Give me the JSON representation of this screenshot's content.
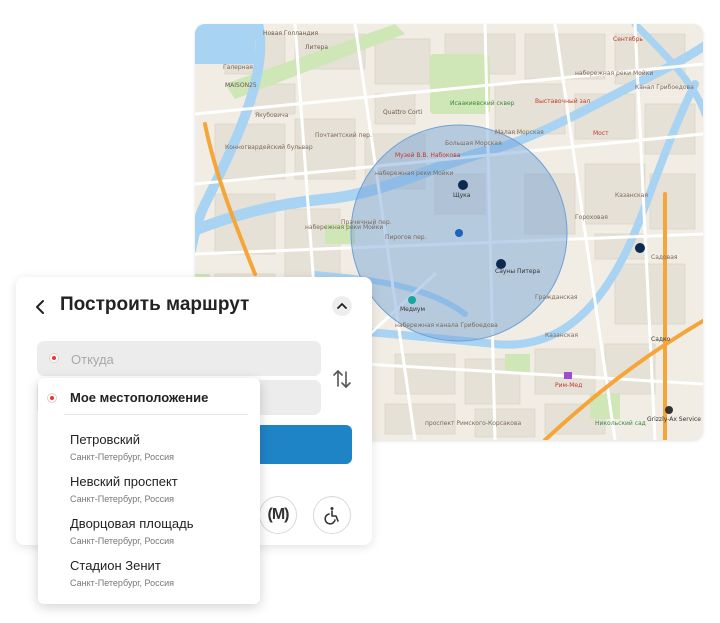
{
  "panel": {
    "title": "Построить маршрут",
    "from_placeholder": "Откуда",
    "to_value": ""
  },
  "dropdown": {
    "current_location": "Мое местоположение",
    "items": [
      {
        "name": "Петровский",
        "sub": "Санкт-Петербург, Россия"
      },
      {
        "name": "Невский проспект",
        "sub": "Санкт-Петербург, Россия"
      },
      {
        "name": "Дворцовая площадь",
        "sub": "Санкт-Петербург, Россия"
      },
      {
        "name": "Стадион Зенит",
        "sub": "Санкт-Петербург, Россия"
      }
    ]
  },
  "map": {
    "labels": {
      "newholland": "Новая Голландия",
      "litera": "Литера",
      "galernaya": "Галерная",
      "maisonsouth": "MAISON25",
      "yakubovicha": "Якубовича",
      "konnogvardeisky": "Конногвардейский бульвар",
      "pochtamtsky": "Почтамтский пер.",
      "quattro": "Quattro Corti",
      "isaac": "Исаакиевский сквер",
      "malaya_morskaya": "Малая Морская",
      "bolshaya_morskaya": "Большая Морская",
      "nabokov": "Музей В.В. Набокова",
      "moika1": "набережная реки Мойки",
      "moika2": "набережная реки Мойки",
      "moika3": "набережная реки Мойки",
      "shchuka": "Щука",
      "pirogov": "Пирогов пер.",
      "prachechny": "Прачечный пер.",
      "saunas": "Сауны Питера",
      "medium": "Медиум",
      "kazanskaya": "Казанская",
      "griboedova": "набережная канала Грибоедова",
      "kazanskaya2": "Казанская",
      "gorokhovaya": "Гороховая",
      "grazhdanskaya": "Гражданская",
      "sadovaya": "Садовая",
      "rimsky": "проспект Римского-Корсакова",
      "rimmed": "Рим-Мед",
      "grizzly": "Grizzly-Ax Service",
      "sadko": "Садко",
      "vystavochny": "Выставочный зал",
      "most": "Мост",
      "sentyabr": "Сентябрь",
      "kanal": "Канал Грибоедова",
      "nikolsky": "Никольский сад"
    },
    "badge_shchuka": "1",
    "badge_saunas": "ЕЛ",
    "badge_right": "ЕЛ"
  },
  "colors": {
    "accent": "#1f84c6",
    "water": "#a9d3f2",
    "radius": "#6f9fd6",
    "marker": "#e53935"
  }
}
